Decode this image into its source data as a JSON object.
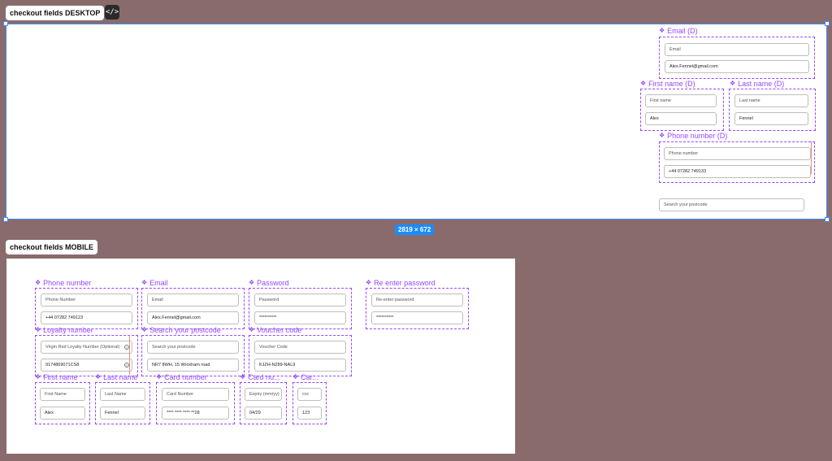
{
  "desktop": {
    "label": "checkout fields DESKTOP",
    "code_icon": "code-icon",
    "size_badge": "2819 × 672",
    "email": {
      "title": "Email (D)",
      "placeholder": "Email",
      "value": "Alex.Fennel@gmail.com"
    },
    "first_name": {
      "title": "First name (D)",
      "placeholder": "First name",
      "value": "Alex"
    },
    "last_name": {
      "title": "Last name (D)",
      "placeholder": "Last name",
      "value": "Fennel"
    },
    "phone": {
      "title": "Phone number (D)",
      "placeholder": "Phone number",
      "value": "+44 07282 749133"
    },
    "postcode": {
      "placeholder": "Search your postcode"
    }
  },
  "mobile": {
    "label": "checkout fields MOBILE",
    "phone": {
      "title": "Phone number",
      "placeholder": "Phone Number",
      "value": "+44 07282 749123"
    },
    "email": {
      "title": "Email",
      "placeholder": "Email",
      "value": "Alex.Fennel@gmail.com"
    },
    "password": {
      "title": "Password",
      "placeholder": "Password",
      "value": "**********"
    },
    "reenter": {
      "title": "Re enter password",
      "placeholder": "Re-enter password",
      "value": "**********"
    },
    "loyalty": {
      "title": "Loyalty number",
      "placeholder": "Virgin Red Loyalty Number (Optional)",
      "value": "9174869071CS8"
    },
    "postcode": {
      "title": "Search your postcode",
      "placeholder": "Search your postcode",
      "value": "NR7 8WH, 15 Wroxham road"
    },
    "voucher": {
      "title": "Voucher code",
      "placeholder": "Voucher Code",
      "value": "KJZH-N289-NAL9"
    },
    "first_name": {
      "title": "First name",
      "placeholder": "First Name",
      "value": "Alex"
    },
    "last_name": {
      "title": "Last name",
      "placeholder": "Last Name",
      "value": "Fennel"
    },
    "card_number": {
      "title": "Card number",
      "placeholder": "Card Number",
      "value": "**** **** **** **28"
    },
    "card_expiry": {
      "title": "Card nu...",
      "placeholder": "Expiry (mm/yy)",
      "value": "04/29"
    },
    "card_cvc": {
      "title": "Car...",
      "placeholder": "cvc",
      "value": "123"
    }
  }
}
